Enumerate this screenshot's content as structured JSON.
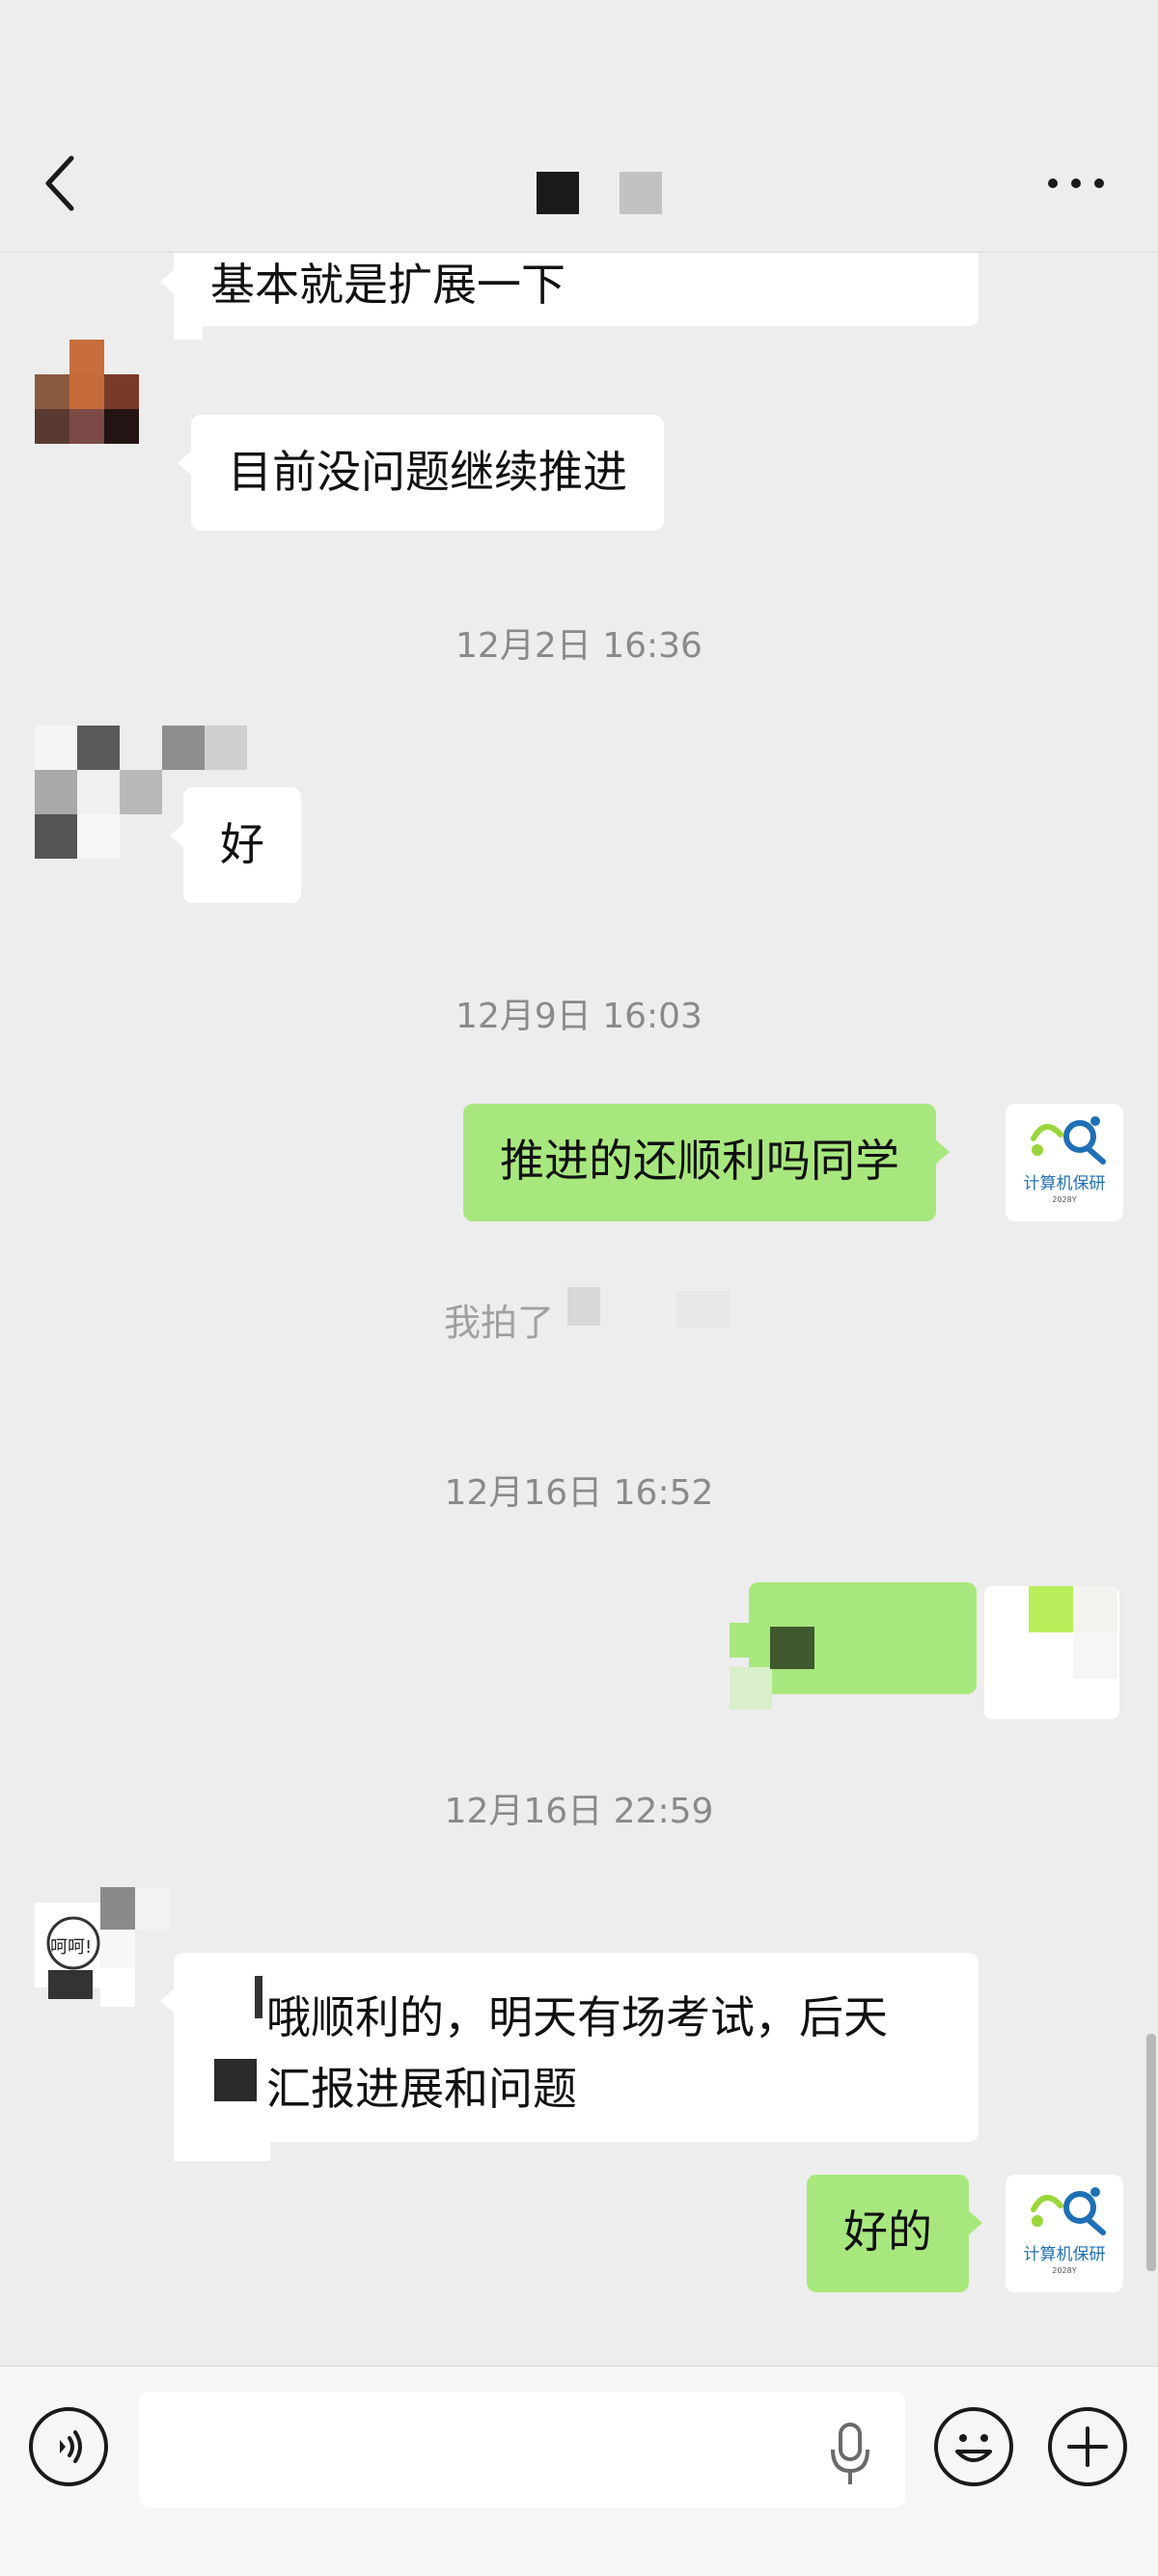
{
  "header": {
    "title": ""
  },
  "messages": {
    "m1_text": "基本就是扩展一下",
    "m2_text": "目前没问题继续推进",
    "time1": "12月2日 16:36",
    "m3_text": "好",
    "time2": "12月9日 16:03",
    "m4_text": "推进的还顺利吗同学",
    "system_note": "我拍了",
    "time3": "12月16日 16:52",
    "time4": "12月16日 22:59",
    "m6_line1": "哦顺利的，明天有场考试，后天",
    "m6_line2": "汇报进展和问题",
    "m7_text": "好的"
  },
  "avatar_logo": {
    "name": "计算机保研",
    "sub": "2028Y"
  },
  "input": {
    "placeholder": "",
    "value": ""
  },
  "colors": {
    "background": "#ededed",
    "incoming_bubble": "#ffffff",
    "outgoing_bubble": "#a8e77e",
    "timestamp": "#8a8a8a",
    "logo_blue": "#1f6fb5",
    "logo_green": "#9bd53a"
  },
  "icons": [
    "back-arrow-icon",
    "more-dots-icon",
    "voice-icon",
    "microphone-icon",
    "emoji-icon",
    "plus-icon"
  ]
}
